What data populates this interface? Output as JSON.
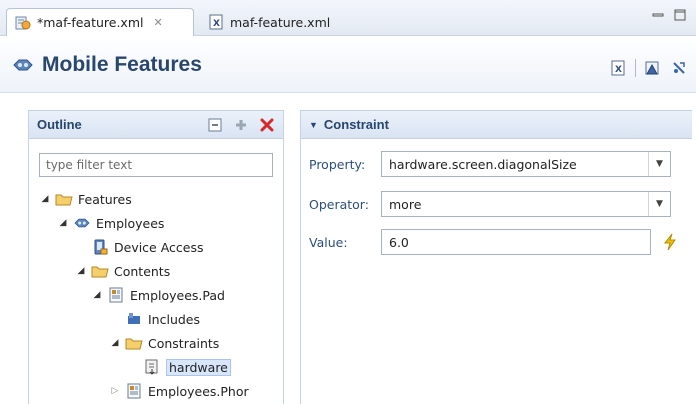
{
  "tabs": [
    {
      "label": "*maf-feature.xml",
      "icon": "feature-file-icon",
      "active": true
    },
    {
      "label": "maf-feature.xml",
      "icon": "xml-file-icon",
      "active": false
    }
  ],
  "header": {
    "title": "Mobile Features",
    "icon": "mobile-features-icon",
    "tools": [
      "xml-view-icon",
      "warnings-icon",
      "disconnect-icon"
    ]
  },
  "outline": {
    "title": "Outline",
    "filter_placeholder": "type filter text",
    "tree": [
      {
        "label": "Features",
        "icon": "folder-icon",
        "expanded": true
      },
      {
        "label": "Employees",
        "icon": "feature-icon",
        "expanded": true
      },
      {
        "label": "Device Access",
        "icon": "device-access-icon"
      },
      {
        "label": "Contents",
        "icon": "folder-icon",
        "expanded": true
      },
      {
        "label": "Employees.Pad",
        "icon": "content-icon",
        "expanded": true
      },
      {
        "label": "Includes",
        "icon": "includes-icon"
      },
      {
        "label": "Constraints",
        "icon": "folder-icon",
        "expanded": true
      },
      {
        "label": "hardware",
        "icon": "constraint-icon",
        "selected": true
      },
      {
        "label": "Employees.Phor",
        "icon": "content-icon",
        "expanded": false
      }
    ]
  },
  "constraint": {
    "title": "Constraint",
    "property_label": "Property:",
    "property_value": "hardware.screen.diagonalSize",
    "operator_label": "Operator:",
    "operator_value": "more",
    "value_label": "Value:",
    "value_value": "6.0"
  },
  "colors": {
    "header_text": "#29476d",
    "panel_title": "#27466f",
    "label_text": "#2b4f78",
    "delete_red": "#d42a2a",
    "bolt_yellow": "#f2c200"
  }
}
